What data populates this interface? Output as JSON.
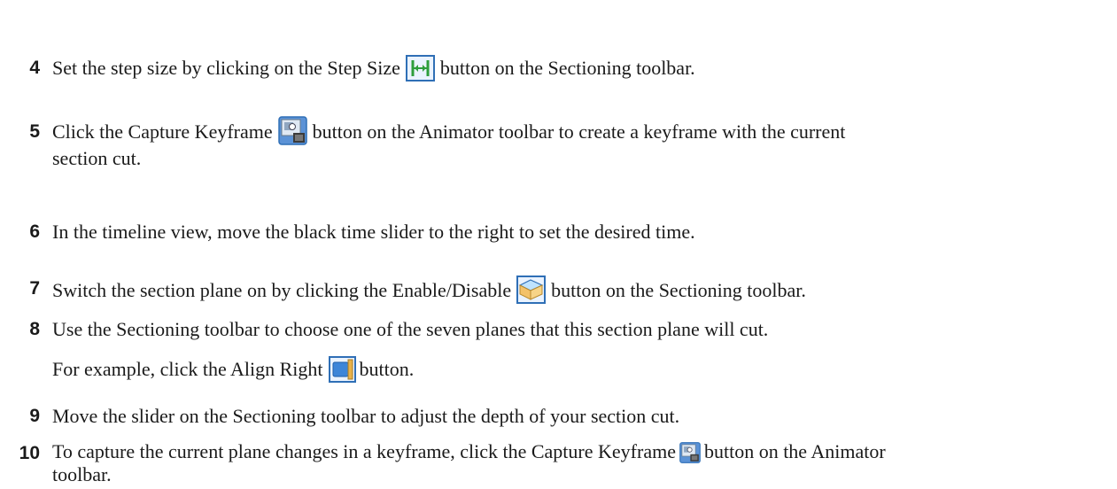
{
  "steps": [
    {
      "number": "4",
      "before": "Set the step size by clicking on the Step Size",
      "icon": "step-size-icon",
      "after": "button on the Sectioning toolbar."
    },
    {
      "number": "5",
      "before": "Click the Capture Keyframe",
      "icon": "capture-keyframe-icon",
      "after": "button on the Animator toolbar to create a keyframe with the current",
      "line2": "section cut."
    },
    {
      "number": "6",
      "text": "In the timeline view, move the black time slider to the right to set the desired time."
    },
    {
      "number": "7",
      "before": "Switch the section plane on by clicking the Enable/Disable",
      "icon": "enable-disable-icon",
      "after": "button on the Sectioning toolbar."
    },
    {
      "number": "8",
      "text": "Use the Sectioning toolbar to choose one of the seven planes that this section plane will cut.",
      "para_before": "For example, click the Align Right",
      "para_icon": "align-right-icon",
      "para_after": "button."
    },
    {
      "number": "9",
      "text": "Move the slider on the Sectioning toolbar to adjust the depth of your section cut."
    },
    {
      "number": "10",
      "before": "To capture the current plane changes in a keyframe, click the Capture Keyframe",
      "icon": "capture-keyframe-icon",
      "after": "button on the Animator",
      "line2": "toolbar."
    }
  ],
  "colors": {
    "text": "#1a1a1a",
    "icon_blue": "#2f6fb6",
    "icon_green": "#2e9e3c",
    "icon_gray": "#8a8a8a"
  }
}
